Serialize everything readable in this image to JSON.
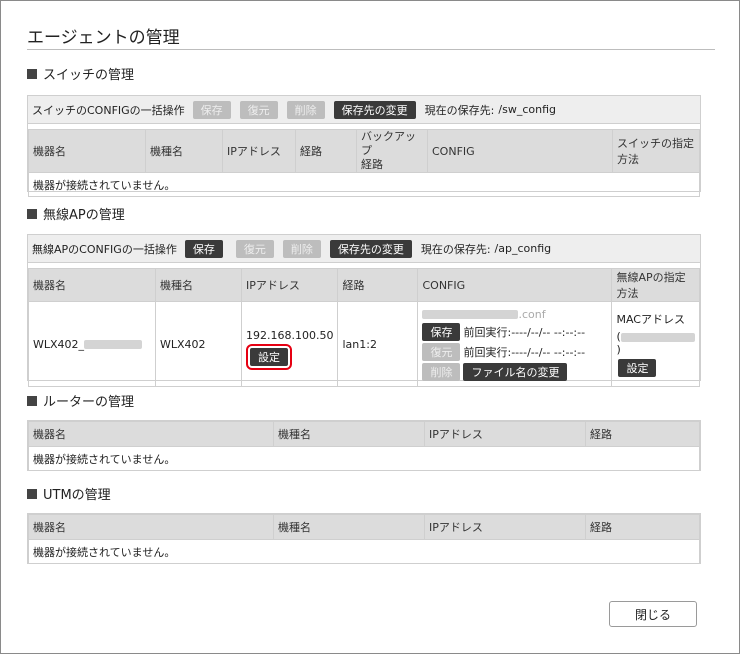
{
  "page_title": "エージェントの管理",
  "switch": {
    "heading": "スイッチの管理",
    "bulk_label": "スイッチのCONFIGの一括操作",
    "save": "保存",
    "restore": "復元",
    "delete": "削除",
    "change_dest": "保存先の変更",
    "dest_label": "現在の保存先:",
    "dest_value": "/sw_config",
    "columns": [
      "機器名",
      "機種名",
      "IPアドレス",
      "経路",
      "バックアップ経路",
      "CONFIG",
      "スイッチの指定方法"
    ],
    "col_backup_1": "バックアップ",
    "col_backup_2": "経路",
    "empty": "機器が接続されていません。"
  },
  "ap": {
    "heading": "無線APの管理",
    "bulk_label": "無線APのCONFIGの一括操作",
    "save": "保存",
    "restore": "復元",
    "delete": "削除",
    "change_dest": "保存先の変更",
    "dest_label": "現在の保存先:",
    "dest_value": "/ap_config",
    "columns": [
      "機器名",
      "機種名",
      "IPアドレス",
      "経路",
      "CONFIG",
      "無線APの指定方法"
    ],
    "row": {
      "device_name": "WLX402_",
      "model": "WLX402",
      "ip": "192.168.100.50",
      "ip_setting": "設定",
      "route": "lan1:2",
      "config_file_suffix": ".conf",
      "cfg_save": "保存",
      "cfg_restore": "復元",
      "cfg_delete": "削除",
      "last_exec_1": "前回実行:----/--/-- --:--:--",
      "last_exec_2": "前回実行:----/--/-- --:--:--",
      "rename": "ファイル名の変更",
      "spec_label": "MACアドレス",
      "spec_open": "(",
      "spec_close": ")",
      "spec_setting": "設定"
    }
  },
  "router": {
    "heading": "ルーターの管理",
    "columns": [
      "機器名",
      "機種名",
      "IPアドレス",
      "経路"
    ],
    "empty": "機器が接続されていません。"
  },
  "utm": {
    "heading": "UTMの管理",
    "columns": [
      "機器名",
      "機種名",
      "IPアドレス",
      "経路"
    ],
    "empty": "機器が接続されていません。"
  },
  "close": "閉じる"
}
